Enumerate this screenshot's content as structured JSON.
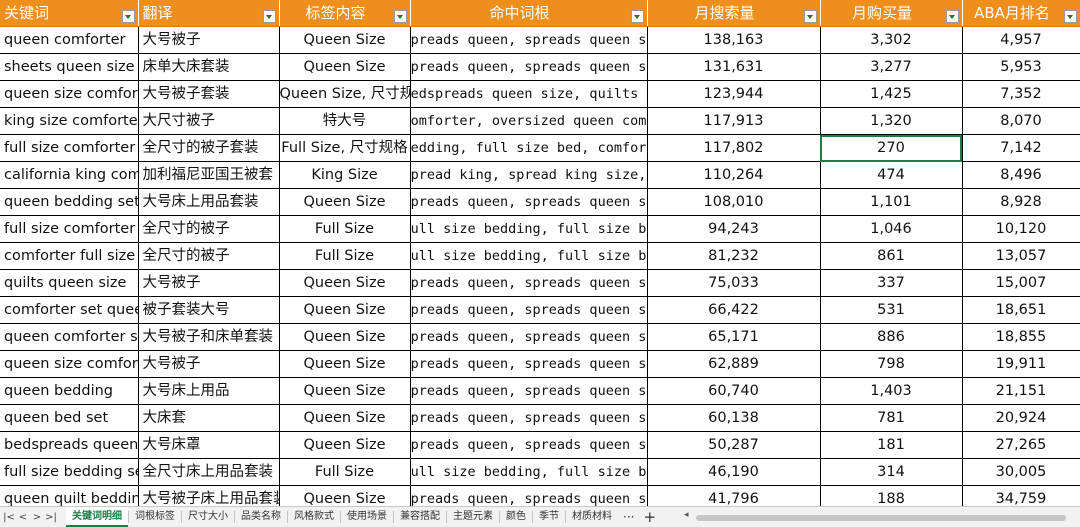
{
  "columns": [
    {
      "label": "关键词",
      "cls": "kw"
    },
    {
      "label": "翻译",
      "cls": "tr"
    },
    {
      "label": "标签内容",
      "cls": "tag"
    },
    {
      "label": "命中词根",
      "cls": "root"
    },
    {
      "label": "月搜索量",
      "cls": "num"
    },
    {
      "label": "月购买量",
      "cls": "num"
    },
    {
      "label": "ABA月排名",
      "cls": "num"
    }
  ],
  "rows": [
    [
      "queen comforter",
      "大号被子",
      "Queen Size",
      "spreads queen, spreads queen size, q",
      "138,163",
      "3,302",
      "4,957"
    ],
    [
      "sheets queen size bed",
      "床单大床套装",
      "Queen Size",
      "spreads queen, spreads queen size, q",
      "131,631",
      "3,277",
      "5,953"
    ],
    [
      "queen size comforter set",
      "大号被子套装",
      "Queen Size, 尺寸规格",
      "bedspreads queen size, quilts queen",
      "123,944",
      "1,425",
      "7,352"
    ],
    [
      "king size comforter",
      "大尺寸被子",
      "特大号",
      "comforter, oversized queen comforter",
      "117,913",
      "1,320",
      "8,070"
    ],
    [
      "full size comforter set",
      "全尺寸的被子套装",
      "Full Size, 尺寸规格",
      "bedding, full size bed, comforter",
      "117,802",
      "270",
      "7,142"
    ],
    [
      "california king comforter",
      "加利福尼亚国王被套",
      "King Size",
      "spread king, spread king size, comfo",
      "110,264",
      "474",
      "8,496"
    ],
    [
      "queen bedding sets",
      "大号床上用品套装",
      "Queen Size",
      "spreads queen, spreads queen size, q",
      "108,010",
      "1,101",
      "8,928"
    ],
    [
      "full size comforter",
      "全尺寸的被子",
      "Full Size",
      "full size bedding, full size bed",
      "94,243",
      "1,046",
      "10,120"
    ],
    [
      "comforter full size",
      "全尺寸的被子",
      "Full Size",
      "full size bedding, full size bed",
      "81,232",
      "861",
      "13,057"
    ],
    [
      "quilts queen size",
      "大号被子",
      "Queen Size",
      "spreads queen, spreads queen size, q",
      "75,033",
      "337",
      "15,007"
    ],
    [
      "comforter set queen",
      "被子套装大号",
      "Queen Size",
      "spreads queen, spreads queen size, q",
      "66,422",
      "531",
      "18,651"
    ],
    [
      "queen comforter set",
      "大号被子和床单套装",
      "Queen Size",
      "spreads queen, spreads queen size, q",
      "65,171",
      "886",
      "18,855"
    ],
    [
      "queen size comforter",
      "大号被子",
      "Queen Size",
      "spreads queen, spreads queen size, q",
      "62,889",
      "798",
      "19,911"
    ],
    [
      "queen bedding",
      "大号床上用品",
      "Queen Size",
      "spreads queen, spreads queen size, q",
      "60,740",
      "1,403",
      "21,151"
    ],
    [
      "queen bed set",
      "大床套",
      "Queen Size",
      "spreads queen, spreads queen size, q",
      "60,138",
      "781",
      "20,924"
    ],
    [
      "bedspreads queen size",
      "大号床罩",
      "Queen Size",
      "spreads queen, spreads queen size, q",
      "50,287",
      "181",
      "27,265"
    ],
    [
      "full size bedding set",
      "全尺寸床上用品套装",
      "Full Size",
      "full size bedding, full size bed",
      "46,190",
      "314",
      "30,005"
    ],
    [
      "queen quilt bedding",
      "大号被子床上用品套装",
      "Queen Size",
      "spreads queen, spreads queen size, q",
      "41,796",
      "188",
      "34,759"
    ]
  ],
  "selected_cell": {
    "row": 4,
    "col": 5
  },
  "tabs": [
    "关键词明细",
    "词根标签",
    "尺寸大小",
    "品类名称",
    "风格款式",
    "使用场景",
    "兼容搭配",
    "主题元素",
    "颜色",
    "季节",
    "材质材料"
  ],
  "active_tab": 0,
  "tab_more": "···",
  "tab_add": "+",
  "nav": {
    "first": "|<",
    "prev": "<",
    "next": ">",
    "last": ">|"
  },
  "colors": {
    "header_bg": "#ee8e1c",
    "active_tab": "#1e7e46"
  }
}
